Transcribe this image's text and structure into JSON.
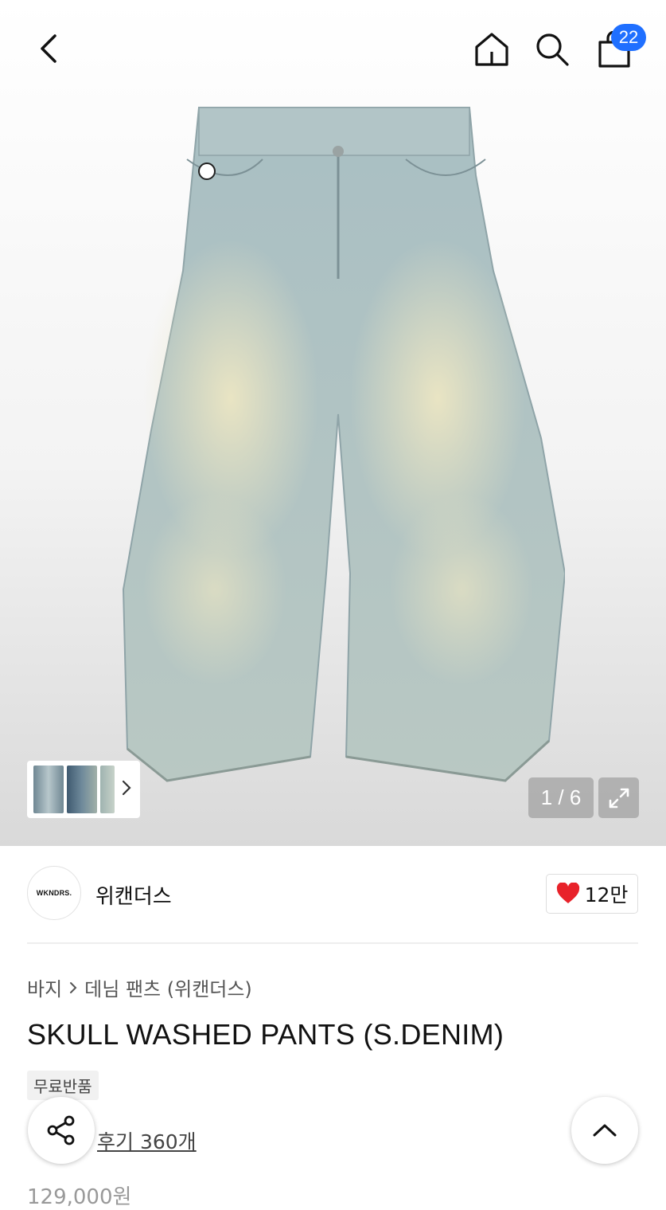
{
  "header": {
    "cart_count": "22",
    "icons": [
      "back-icon",
      "home-icon",
      "search-icon",
      "shopping-bag-icon"
    ]
  },
  "gallery": {
    "counter": "1 / 6",
    "colors": {
      "denim_light": "#b8c9c9",
      "denim_fade": "#e6e2bf"
    }
  },
  "brand": {
    "logo_text": "WKNDRS.",
    "name": "위캔더스",
    "likes": "12만"
  },
  "breadcrumb": {
    "category": "바지",
    "subcategory": "데님 팬츠 (위캔더스)"
  },
  "product": {
    "title": "SKULL WASHED PANTS (S.DENIM)",
    "tag": "무료반품",
    "reviews": "후기 360개",
    "price": "129,000원"
  },
  "accent_colors": {
    "badge": "#1f6fff",
    "heart": "#e8222a"
  }
}
